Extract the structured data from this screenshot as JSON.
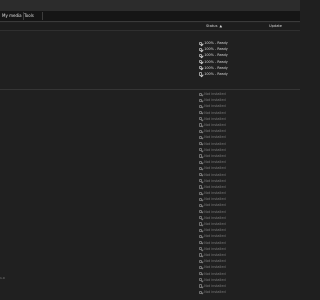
{
  "tabs": [
    {
      "label": "My media"
    },
    {
      "label": "Tools"
    }
  ],
  "columns": {
    "status": "Status",
    "update": "Update"
  },
  "left_mark": "1.0",
  "ready_items": [
    {
      "status": "100% - Ready"
    },
    {
      "status": "100% - Ready"
    },
    {
      "status": "100% - Ready"
    },
    {
      "status": "100% - Ready"
    },
    {
      "status": "100% - Ready"
    },
    {
      "status": "100% - Ready"
    }
  ],
  "not_installed_items": [
    {
      "status": "Not installed"
    },
    {
      "status": "Not installed"
    },
    {
      "status": "Not installed"
    },
    {
      "status": "Not installed"
    },
    {
      "status": "Not installed"
    },
    {
      "status": "Not installed"
    },
    {
      "status": "Not installed"
    },
    {
      "status": "Not installed"
    },
    {
      "status": "Not installed"
    },
    {
      "status": "Not installed"
    },
    {
      "status": "Not installed"
    },
    {
      "status": "Not installed"
    },
    {
      "status": "Not installed"
    },
    {
      "status": "Not installed"
    },
    {
      "status": "Not installed"
    },
    {
      "status": "Not installed"
    },
    {
      "status": "Not installed"
    },
    {
      "status": "Not installed"
    },
    {
      "status": "Not installed"
    },
    {
      "status": "Not installed"
    },
    {
      "status": "Not installed"
    },
    {
      "status": "Not installed"
    },
    {
      "status": "Not installed"
    },
    {
      "status": "Not installed"
    },
    {
      "status": "Not installed"
    },
    {
      "status": "Not installed"
    },
    {
      "status": "Not installed"
    },
    {
      "status": "Not installed"
    },
    {
      "status": "Not installed"
    },
    {
      "status": "Not installed"
    },
    {
      "status": "Not installed"
    },
    {
      "status": "Not installed"
    },
    {
      "status": "Not installed"
    }
  ]
}
